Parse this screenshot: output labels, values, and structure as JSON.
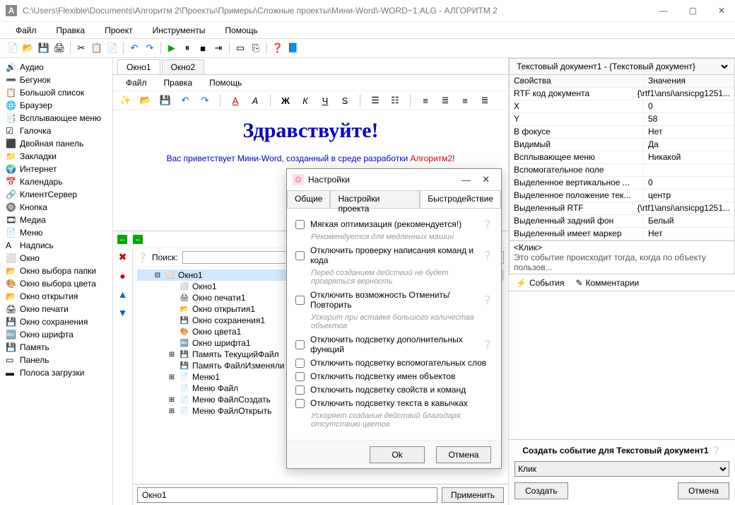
{
  "window": {
    "app_icon": "A",
    "title": "C:\\Users\\Flexible\\Documents\\Алгоритм 2\\Проекты\\Примеры\\Сложные проекты\\Мини-Word\\-WORD~1.ALG - АЛГОРИТМ 2",
    "btn_min": "—",
    "btn_max": "▢",
    "btn_close": "✕"
  },
  "menubar": [
    "Файл",
    "Правка",
    "Проект",
    "Инструменты",
    "Помощь"
  ],
  "left_items": [
    {
      "icon": "🔊",
      "label": "Аудио"
    },
    {
      "icon": "➖",
      "label": "Бегунок"
    },
    {
      "icon": "📋",
      "label": "Большой список"
    },
    {
      "icon": "🌐",
      "label": "Браузер"
    },
    {
      "icon": "📑",
      "label": "Всплывающее меню"
    },
    {
      "icon": "☑",
      "label": "Галочка"
    },
    {
      "icon": "⬛",
      "label": "Двойная панель"
    },
    {
      "icon": "📁",
      "label": "Закладки"
    },
    {
      "icon": "🌍",
      "label": "Интернет"
    },
    {
      "icon": "📅",
      "label": "Календарь"
    },
    {
      "icon": "🔗",
      "label": "КлиентСервер"
    },
    {
      "icon": "🔘",
      "label": "Кнопка"
    },
    {
      "icon": "🎞",
      "label": "Медиа"
    },
    {
      "icon": "📄",
      "label": "Меню"
    },
    {
      "icon": "A",
      "label": "Надпись"
    },
    {
      "icon": "⬜",
      "label": "Окно"
    },
    {
      "icon": "📂",
      "label": "Окно выбора папки"
    },
    {
      "icon": "🎨",
      "label": "Окно выбора цвета"
    },
    {
      "icon": "📂",
      "label": "Окно открытия"
    },
    {
      "icon": "🖨",
      "label": "Окно печати"
    },
    {
      "icon": "💾",
      "label": "Окно сохранения"
    },
    {
      "icon": "🔤",
      "label": "Окно шрифта"
    },
    {
      "icon": "💾",
      "label": "Память"
    },
    {
      "icon": "▭",
      "label": "Панель"
    },
    {
      "icon": "▬",
      "label": "Полоса загрузки"
    }
  ],
  "center": {
    "tabs": [
      "Окно1",
      "Окно2"
    ],
    "doc_menu": [
      "Файл",
      "Правка",
      "Помощь"
    ],
    "doc_heading": "Здравствуйте!",
    "doc_text_pre": "Вас приветствует Мини-Word, созданный в среде разработки ",
    "doc_text_red": "Алгоритм2",
    "doc_text_post": "!",
    "search_label": "Поиск:",
    "tree": [
      {
        "d": 1,
        "exp": "⊟",
        "icon": "⬜",
        "label": "Окно1",
        "sel": true
      },
      {
        "d": 2,
        "exp": "",
        "icon": "⬜",
        "label": "Окно1"
      },
      {
        "d": 2,
        "exp": "",
        "icon": "🖨",
        "label": "Окно печати1"
      },
      {
        "d": 2,
        "exp": "",
        "icon": "📂",
        "label": "Окно открытия1"
      },
      {
        "d": 2,
        "exp": "",
        "icon": "💾",
        "label": "Окно сохранения1"
      },
      {
        "d": 2,
        "exp": "",
        "icon": "🎨",
        "label": "Окно цвета1"
      },
      {
        "d": 2,
        "exp": "",
        "icon": "🔤",
        "label": "Окно шрифта1"
      },
      {
        "d": 2,
        "exp": "⊞",
        "icon": "💾",
        "label": "Память ТекущийФайл"
      },
      {
        "d": 2,
        "exp": "",
        "icon": "💾",
        "label": "Память ФайлИзменяли"
      },
      {
        "d": 2,
        "exp": "⊞",
        "icon": "📄",
        "label": "Меню1"
      },
      {
        "d": 2,
        "exp": "",
        "icon": "📄",
        "label": "Меню Файл"
      },
      {
        "d": 2,
        "exp": "⊞",
        "icon": "📄",
        "label": "Меню ФайлСоздать"
      },
      {
        "d": 2,
        "exp": "⊞",
        "icon": "📄",
        "label": "Меню ФайлОткрыть"
      }
    ],
    "bottom_value": "Окно1",
    "bottom_btn": "Применить"
  },
  "right": {
    "selector": "Текстовый документ1 - {Текстовый документ}",
    "prop_header_k": "Свойства",
    "prop_header_v": "Значения",
    "props": [
      {
        "k": "RTF код документа",
        "v": "{\\rtf1\\ansi\\ansicpg1251..."
      },
      {
        "k": "X",
        "v": "0"
      },
      {
        "k": "Y",
        "v": "58"
      },
      {
        "k": "В фокусе",
        "v": "Нет"
      },
      {
        "k": "Видимый",
        "v": "Да"
      },
      {
        "k": "Всплывающее меню",
        "v": "Никакой"
      },
      {
        "k": "Вспомогательное поле",
        "v": ""
      },
      {
        "k": "Выделенное вертикальное ...",
        "v": "0"
      },
      {
        "k": "Выделенное положение тек...",
        "v": "центр"
      },
      {
        "k": "Выделенный RTF",
        "v": "{\\rtf1\\ansi\\ansicpg1251..."
      },
      {
        "k": "Выделенный задний фон",
        "v": "Белый"
      },
      {
        "k": "Выделенный имеет маркер",
        "v": "Нет"
      }
    ],
    "event_name": "<Клик>",
    "event_desc": "Это событие происходит тогда, когда по объекту пользов...",
    "event_tabs": [
      "События",
      "Комментарии"
    ],
    "create_label_pre": "Создать событие для ",
    "create_label_obj": "Текстовый документ1",
    "create_select": "Клик",
    "btn_create": "Создать",
    "btn_cancel": "Отмена"
  },
  "dialog": {
    "title": "Настройки",
    "tabs": [
      "Общие",
      "Настройки проекта",
      "Быстродействие"
    ],
    "active_tab": 2,
    "opts": [
      {
        "label": "Мягкая оптимизация (рекомендуется!)",
        "hint": "Рекомендуется для медленных машин",
        "help": true
      },
      {
        "label": "Отключить проверку написания команд и кода",
        "hint": "Перед созданием действий не будет провряться верность",
        "help": true
      },
      {
        "label": "Отключить возможность Отменить/Повторить",
        "hint": "Ускорит при вставке большого количества объектов",
        "help": true
      },
      {
        "label": "Отключить подсветку дополнительных функций",
        "hint": "",
        "help": true
      },
      {
        "label": "Отключить подсветку вспомогательных слов",
        "hint": "",
        "help": false
      },
      {
        "label": "Отключить подсветку имен объектов",
        "hint": "",
        "help": false
      },
      {
        "label": "Отключить подсветку свойств и команд",
        "hint": "",
        "help": false
      },
      {
        "label": "Отключить подсветку текста в кавычках",
        "hint": "Ускоряет создание действий благодаря отсутствию цветов",
        "help": false
      }
    ],
    "btn_ok": "Ok",
    "btn_cancel": "Отмена",
    "btn_min": "—",
    "btn_close": "✕"
  }
}
